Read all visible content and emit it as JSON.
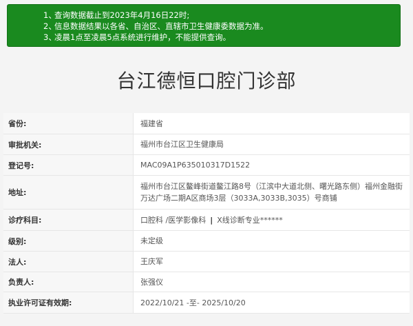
{
  "notice": {
    "items": [
      {
        "num": "1、",
        "text": "查询数据截止到2023年4月16日22时;"
      },
      {
        "num": "2、",
        "text": "信息数据结果以各省、自治区、直辖市卫生健康委数据为准。"
      },
      {
        "num": "3、",
        "text": "凌晨1点至凌晨5点系统进行维护，不能提供查询。"
      }
    ]
  },
  "page_title": "台江德恒口腔门诊部",
  "info": {
    "rows": [
      {
        "label": "省份:",
        "value": "福建省"
      },
      {
        "label": "审批机关:",
        "value": "福州市台江区卫生健康局"
      },
      {
        "label": "登记号:",
        "value": "MAC09A1P635010317D1522"
      },
      {
        "label": "地址:",
        "value": "福州市台江区鳌峰街道鳌江路8号（江滨中大道北侧、曙光路东侧）福州金融街万达广场二期A区商场3层（3033A,3033B,3035）号商铺"
      },
      {
        "label": "诊疗科目:",
        "value_parts": [
          "口腔科 /医学影像科",
          "|",
          "X线诊断专业******"
        ]
      },
      {
        "label": "级别:",
        "value": "未定级"
      },
      {
        "label": "法人:",
        "value": "王庆军"
      },
      {
        "label": "负责人:",
        "value": "张强仪"
      },
      {
        "label": "执业许可证有效期:",
        "value": "2022/10/21 -至- 2025/10/20"
      }
    ]
  }
}
